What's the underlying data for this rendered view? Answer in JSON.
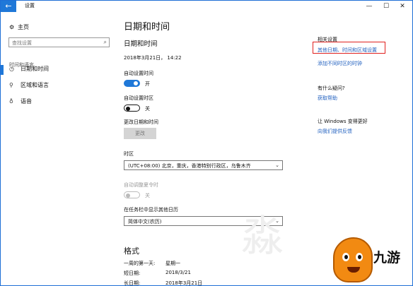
{
  "window": {
    "title": "设置"
  },
  "sidebar": {
    "home_label": "主页",
    "search_placeholder": "查找设置",
    "section_label": "时间和语言",
    "items": [
      {
        "label": "日期和时间",
        "icon": "clock-icon",
        "active": true
      },
      {
        "label": "区域和语言",
        "icon": "region-language-icon",
        "active": false
      },
      {
        "label": "语音",
        "icon": "microphone-icon",
        "active": false
      }
    ]
  },
  "main": {
    "page_title": "日期和时间",
    "section_title": "日期和时间",
    "current_datetime": "2018年3月21日， 14:22",
    "auto_time": {
      "label": "自动设置时间",
      "state": "开"
    },
    "auto_timezone": {
      "label": "自动设置时区",
      "state": "关"
    },
    "change_datetime": {
      "label": "更改日期和时间",
      "button": "更改"
    },
    "timezone": {
      "label": "时区",
      "value": "(UTC+08:00) 北京，重庆，香港特别行政区，乌鲁木齐"
    },
    "dst": {
      "label": "自动调整夏令时",
      "state": "关"
    },
    "calendar": {
      "label": "在任务栏中显示其他日历",
      "value": "简体中文(农历)"
    },
    "formats": {
      "title": "格式",
      "rows": [
        {
          "label": "一周的第一天:",
          "value": "星期一"
        },
        {
          "label": "短日期:",
          "value": "2018/3/21"
        },
        {
          "label": "长日期:",
          "value": "2018年3月21日"
        }
      ]
    }
  },
  "related": {
    "heading": "相关设置",
    "links": [
      "其他日期、时间和区域设置",
      "添加不同时区的时钟"
    ],
    "question_heading": "有什么疑问?",
    "help_link": "获取帮助",
    "better_heading": "让 Windows 变得更好",
    "feedback_link": "向我们提供反馈"
  },
  "watermark": {
    "logo_text": "九游"
  },
  "colors": {
    "accent": "#1f78d8",
    "highlight_box": "#e0201e"
  }
}
